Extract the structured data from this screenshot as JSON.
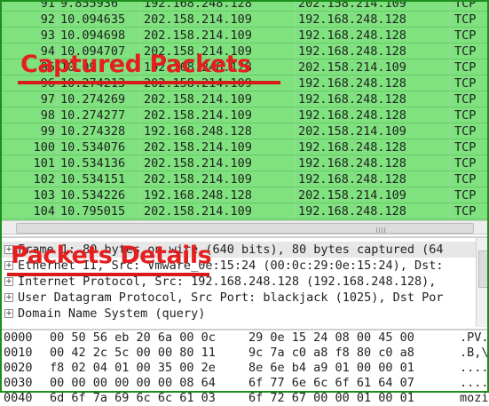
{
  "packets": [
    {
      "no": "91",
      "time": "9.855936",
      "src": "192.168.248.128",
      "dst": "202.158.214.109",
      "proto": "TCP"
    },
    {
      "no": "92",
      "time": "10.094635",
      "src": "202.158.214.109",
      "dst": "192.168.248.128",
      "proto": "TCP"
    },
    {
      "no": "93",
      "time": "10.094698",
      "src": "202.158.214.109",
      "dst": "192.168.248.128",
      "proto": "TCP"
    },
    {
      "no": "94",
      "time": "10.094707",
      "src": "202.158.214.109",
      "dst": "192.168.248.128",
      "proto": "TCP"
    },
    {
      "no": "95",
      "time": "10.09",
      "src": "192.168.248.128",
      "dst": "202.158.214.109",
      "proto": "TCP"
    },
    {
      "no": "96",
      "time": "10.274213",
      "src": "202.158.214.109",
      "dst": "192.168.248.128",
      "proto": "TCP"
    },
    {
      "no": "97",
      "time": "10.274269",
      "src": "202.158.214.109",
      "dst": "192.168.248.128",
      "proto": "TCP"
    },
    {
      "no": "98",
      "time": "10.274277",
      "src": "202.158.214.109",
      "dst": "192.168.248.128",
      "proto": "TCP"
    },
    {
      "no": "99",
      "time": "10.274328",
      "src": "192.168.248.128",
      "dst": "202.158.214.109",
      "proto": "TCP"
    },
    {
      "no": "100",
      "time": "10.534076",
      "src": "202.158.214.109",
      "dst": "192.168.248.128",
      "proto": "TCP"
    },
    {
      "no": "101",
      "time": "10.534136",
      "src": "202.158.214.109",
      "dst": "192.168.248.128",
      "proto": "TCP"
    },
    {
      "no": "102",
      "time": "10.534151",
      "src": "202.158.214.109",
      "dst": "192.168.248.128",
      "proto": "TCP"
    },
    {
      "no": "103",
      "time": "10.534226",
      "src": "192.168.248.128",
      "dst": "202.158.214.109",
      "proto": "TCP"
    },
    {
      "no": "104",
      "time": "10.795015",
      "src": "202.158.214.109",
      "dst": "192.168.248.128",
      "proto": "TCP"
    }
  ],
  "details": [
    {
      "expander": "+",
      "text": "Frame 1: 80 bytes on wire (640 bits), 80 bytes captured (64"
    },
    {
      "expander": "+",
      "text": "Ethernet II, Src: Vmware_0e:15:24 (00:0c:29:0e:15:24), Dst:"
    },
    {
      "expander": "+",
      "text": "Internet Protocol, Src: 192.168.248.128 (192.168.248.128),"
    },
    {
      "expander": "+",
      "text": "User Datagram Protocol, Src Port: blackjack (1025), Dst Por"
    },
    {
      "expander": "+",
      "text": "Domain Name System (query)"
    }
  ],
  "hex": [
    {
      "offset": "0000",
      "b1": "00 50 56 eb 20 6a 00 0c",
      "b2": "29 0e 15 24 08 00 45 00",
      "ascii": ".PV."
    },
    {
      "offset": "0010",
      "b1": "00 42 2c 5c 00 00 80 11",
      "b2": "9c 7a c0 a8 f8 80 c0 a8",
      "ascii": ".B,\\"
    },
    {
      "offset": "0020",
      "b1": "f8 02 04 01 00 35 00 2e",
      "b2": "8e 6e b4 a9 01 00 00 01",
      "ascii": "...."
    },
    {
      "offset": "0030",
      "b1": "00 00 00 00 00 00 08 64",
      "b2": "6f 77 6e 6c 6f 61 64 07",
      "ascii": "...."
    },
    {
      "offset": "0040",
      "b1": "6d 6f 7a 69 6c 6c 61 03",
      "b2": "6f 72 67 00 00 01 00 01",
      "ascii": "mozi"
    }
  ],
  "annotations": {
    "captured_label": "Captured Packets",
    "details_label": "Packets Details"
  },
  "colors": {
    "packet_row_bg": "#7fe27f",
    "annotation_red": "#e31f1f",
    "border_green": "#1b8f1b"
  }
}
